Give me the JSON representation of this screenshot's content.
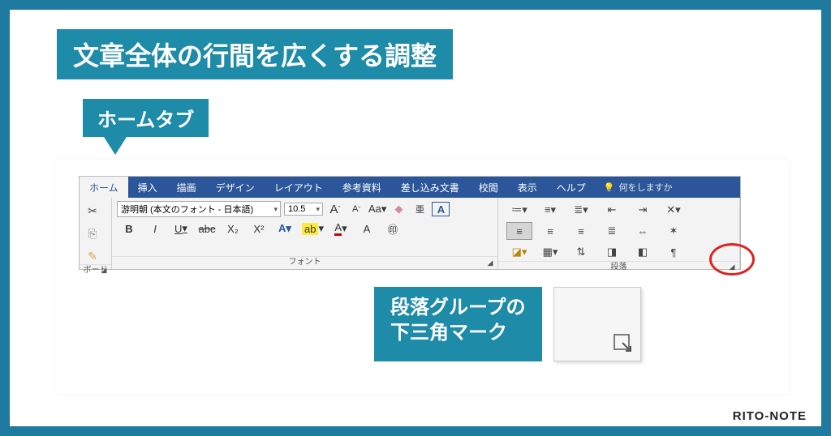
{
  "title": "文章全体の行間を広くする調整",
  "callout_home": "ホームタブ",
  "callout_para_line1": "段落グループの",
  "callout_para_line2": "下三角マーク",
  "watermark": "RITO-NOTE",
  "tabs": {
    "home": "ホーム",
    "insert": "挿入",
    "draw": "描画",
    "design": "デザイン",
    "layout": "レイアウト",
    "references": "参考資料",
    "mailings": "差し込み文書",
    "review": "校閲",
    "view": "表示",
    "help": "ヘルプ",
    "tellme": "何をしますか"
  },
  "clipboard": {
    "label": "ボード"
  },
  "font": {
    "label": "フォント",
    "name": "游明朝 (本文のフォント - 日本語)",
    "size": "10.5",
    "bold": "B",
    "italic": "I",
    "underline": "U",
    "strike": "abc",
    "sub": "X₂",
    "sup": "X²"
  },
  "paragraph": {
    "label": "段落"
  }
}
